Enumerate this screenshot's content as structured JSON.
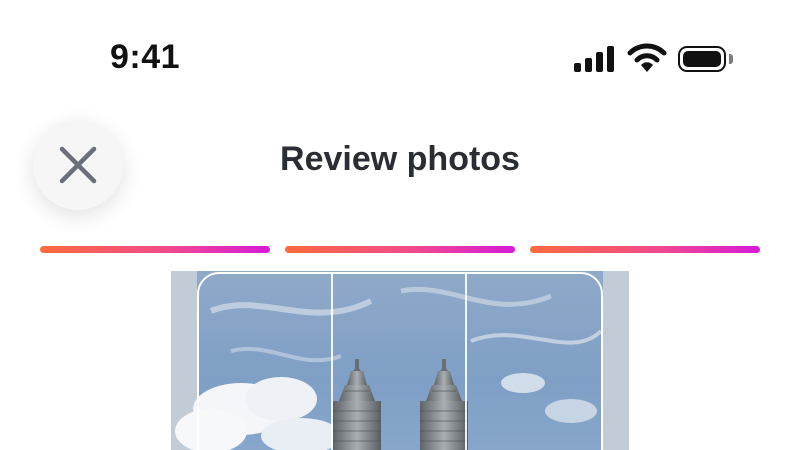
{
  "status_bar": {
    "time": "9:41",
    "icons": [
      "cellular-signal-icon",
      "wifi-icon",
      "battery-icon"
    ]
  },
  "header": {
    "title": "Review photos",
    "close_icon": "close-icon"
  },
  "progress": {
    "segments": 3,
    "completed": 3,
    "gradient_colors": [
      "#ff6a3d",
      "#f24a8c",
      "#d61ad8"
    ]
  },
  "photo": {
    "subject": "twin-towers-photo",
    "grid_icon": "crop-grid"
  },
  "colors": {
    "title_text": "#2a2d34",
    "close_button_bg": "#f6f6f7",
    "close_icon": "#6b6f7a"
  }
}
